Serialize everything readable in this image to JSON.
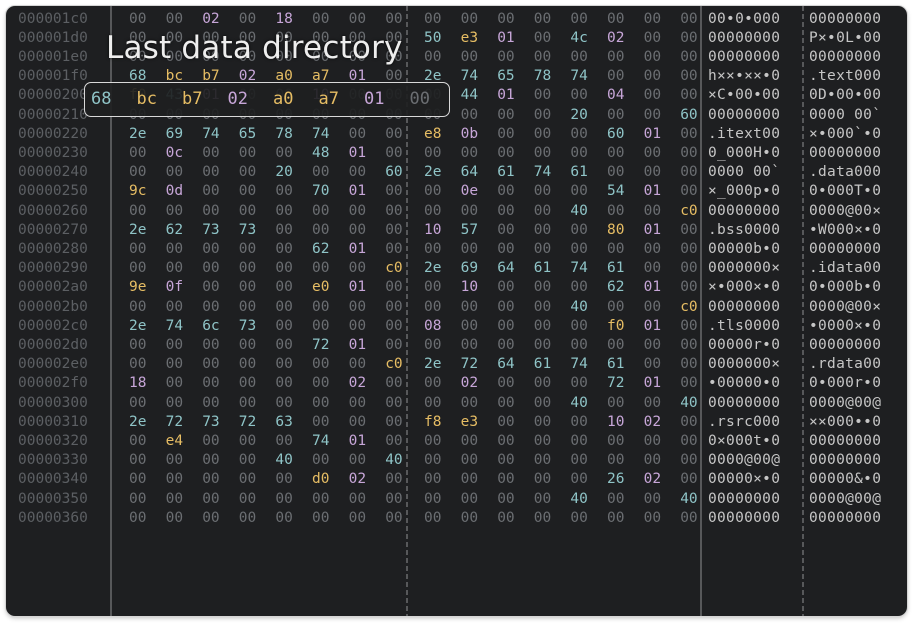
{
  "overlay": {
    "title": "Last data directory",
    "highlight_bytes": [
      {
        "text": "68",
        "color": "cyan"
      },
      {
        "text": "bc",
        "color": "yellow"
      },
      {
        "text": "b7",
        "color": "yellow"
      },
      {
        "text": "02",
        "color": "purple"
      },
      {
        "text": "a0",
        "color": "yellow"
      },
      {
        "text": "a7",
        "color": "yellow"
      },
      {
        "text": "01",
        "color": "purple"
      },
      {
        "text": "00",
        "color": "gray"
      }
    ]
  },
  "colors": {
    "background": "#1e1f21",
    "zero": "#6b6e72",
    "printable": "#8fc4c7",
    "high": "#e6bd64",
    "low": "#c7a6d8"
  },
  "rows": [
    {
      "offset": "000001c0",
      "bytes": [
        "00",
        "00",
        "02",
        "00",
        "18",
        "00",
        "00",
        "00",
        "00",
        "00",
        "00",
        "00",
        "00",
        "00",
        "00",
        "00"
      ],
      "ascii_a": "00•0•000",
      "ascii_b": "00000000"
    },
    {
      "offset": "000001d0",
      "bytes": [
        "00",
        "00",
        "00",
        "00",
        "00",
        "00",
        "00",
        "00",
        "50",
        "e3",
        "01",
        "00",
        "4c",
        "02",
        "00",
        "00"
      ],
      "ascii_a": "00000000",
      "ascii_b": "P×•0L•00"
    },
    {
      "offset": "000001e0",
      "bytes": [
        "00",
        "00",
        "00",
        "00",
        "00",
        "00",
        "00",
        "00",
        "00",
        "00",
        "00",
        "00",
        "00",
        "00",
        "00",
        "00"
      ],
      "ascii_a": "00000000",
      "ascii_b": "00000000"
    },
    {
      "offset": "000001f0",
      "bytes": [
        "68",
        "bc",
        "b7",
        "02",
        "a0",
        "a7",
        "01",
        "00",
        "2e",
        "74",
        "65",
        "78",
        "74",
        "00",
        "00",
        "00"
      ],
      "ascii_a": "h××•××•0",
      "ascii_b": ".text000"
    },
    {
      "offset": "00000200",
      "bytes": [
        "f0",
        "43",
        "01",
        "00",
        "00",
        "10",
        "00",
        "00",
        "00",
        "44",
        "01",
        "00",
        "00",
        "04",
        "00",
        "00"
      ],
      "ascii_a": "×C•00•00",
      "ascii_b": "0D•00•00"
    },
    {
      "offset": "00000210",
      "bytes": [
        "00",
        "00",
        "00",
        "00",
        "00",
        "00",
        "00",
        "00",
        "00",
        "00",
        "00",
        "00",
        "20",
        "00",
        "00",
        "60"
      ],
      "ascii_a": "00000000",
      "ascii_b": "0000 00`"
    },
    {
      "offset": "00000220",
      "bytes": [
        "2e",
        "69",
        "74",
        "65",
        "78",
        "74",
        "00",
        "00",
        "e8",
        "0b",
        "00",
        "00",
        "00",
        "60",
        "01",
        "00"
      ],
      "ascii_a": ".itext00",
      "ascii_b": "×•000`•0"
    },
    {
      "offset": "00000230",
      "bytes": [
        "00",
        "0c",
        "00",
        "00",
        "00",
        "48",
        "01",
        "00",
        "00",
        "00",
        "00",
        "00",
        "00",
        "00",
        "00",
        "00"
      ],
      "ascii_a": "0_000H•0",
      "ascii_b": "00000000"
    },
    {
      "offset": "00000240",
      "bytes": [
        "00",
        "00",
        "00",
        "00",
        "20",
        "00",
        "00",
        "60",
        "2e",
        "64",
        "61",
        "74",
        "61",
        "00",
        "00",
        "00"
      ],
      "ascii_a": "0000 00`",
      "ascii_b": ".data000"
    },
    {
      "offset": "00000250",
      "bytes": [
        "9c",
        "0d",
        "00",
        "00",
        "00",
        "70",
        "01",
        "00",
        "00",
        "0e",
        "00",
        "00",
        "00",
        "54",
        "01",
        "00"
      ],
      "ascii_a": "×_000p•0",
      "ascii_b": "0•000T•0"
    },
    {
      "offset": "00000260",
      "bytes": [
        "00",
        "00",
        "00",
        "00",
        "00",
        "00",
        "00",
        "00",
        "00",
        "00",
        "00",
        "00",
        "40",
        "00",
        "00",
        "c0"
      ],
      "ascii_a": "00000000",
      "ascii_b": "0000@00×"
    },
    {
      "offset": "00000270",
      "bytes": [
        "2e",
        "62",
        "73",
        "73",
        "00",
        "00",
        "00",
        "00",
        "10",
        "57",
        "00",
        "00",
        "00",
        "80",
        "01",
        "00"
      ],
      "ascii_a": ".bss0000",
      "ascii_b": "•W000×•0"
    },
    {
      "offset": "00000280",
      "bytes": [
        "00",
        "00",
        "00",
        "00",
        "00",
        "62",
        "01",
        "00",
        "00",
        "00",
        "00",
        "00",
        "00",
        "00",
        "00",
        "00"
      ],
      "ascii_a": "00000b•0",
      "ascii_b": "00000000"
    },
    {
      "offset": "00000290",
      "bytes": [
        "00",
        "00",
        "00",
        "00",
        "00",
        "00",
        "00",
        "c0",
        "2e",
        "69",
        "64",
        "61",
        "74",
        "61",
        "00",
        "00"
      ],
      "ascii_a": "0000000×",
      "ascii_b": ".idata00"
    },
    {
      "offset": "000002a0",
      "bytes": [
        "9e",
        "0f",
        "00",
        "00",
        "00",
        "e0",
        "01",
        "00",
        "00",
        "10",
        "00",
        "00",
        "00",
        "62",
        "01",
        "00"
      ],
      "ascii_a": "×•000×•0",
      "ascii_b": "0•000b•0"
    },
    {
      "offset": "000002b0",
      "bytes": [
        "00",
        "00",
        "00",
        "00",
        "00",
        "00",
        "00",
        "00",
        "00",
        "00",
        "00",
        "00",
        "40",
        "00",
        "00",
        "c0"
      ],
      "ascii_a": "00000000",
      "ascii_b": "0000@00×"
    },
    {
      "offset": "000002c0",
      "bytes": [
        "2e",
        "74",
        "6c",
        "73",
        "00",
        "00",
        "00",
        "00",
        "08",
        "00",
        "00",
        "00",
        "00",
        "f0",
        "01",
        "00"
      ],
      "ascii_a": ".tls0000",
      "ascii_b": "•0000×•0"
    },
    {
      "offset": "000002d0",
      "bytes": [
        "00",
        "00",
        "00",
        "00",
        "00",
        "72",
        "01",
        "00",
        "00",
        "00",
        "00",
        "00",
        "00",
        "00",
        "00",
        "00"
      ],
      "ascii_a": "00000r•0",
      "ascii_b": "00000000"
    },
    {
      "offset": "000002e0",
      "bytes": [
        "00",
        "00",
        "00",
        "00",
        "00",
        "00",
        "00",
        "c0",
        "2e",
        "72",
        "64",
        "61",
        "74",
        "61",
        "00",
        "00"
      ],
      "ascii_a": "0000000×",
      "ascii_b": ".rdata00"
    },
    {
      "offset": "000002f0",
      "bytes": [
        "18",
        "00",
        "00",
        "00",
        "00",
        "00",
        "02",
        "00",
        "00",
        "02",
        "00",
        "00",
        "00",
        "72",
        "01",
        "00"
      ],
      "ascii_a": "•00000•0",
      "ascii_b": "0•000r•0"
    },
    {
      "offset": "00000300",
      "bytes": [
        "00",
        "00",
        "00",
        "00",
        "00",
        "00",
        "00",
        "00",
        "00",
        "00",
        "00",
        "00",
        "40",
        "00",
        "00",
        "40"
      ],
      "ascii_a": "00000000",
      "ascii_b": "0000@00@"
    },
    {
      "offset": "00000310",
      "bytes": [
        "2e",
        "72",
        "73",
        "72",
        "63",
        "00",
        "00",
        "00",
        "f8",
        "e3",
        "00",
        "00",
        "00",
        "10",
        "02",
        "00"
      ],
      "ascii_a": ".rsrc000",
      "ascii_b": "××000••0"
    },
    {
      "offset": "00000320",
      "bytes": [
        "00",
        "e4",
        "00",
        "00",
        "00",
        "74",
        "01",
        "00",
        "00",
        "00",
        "00",
        "00",
        "00",
        "00",
        "00",
        "00"
      ],
      "ascii_a": "0×000t•0",
      "ascii_b": "00000000"
    },
    {
      "offset": "00000330",
      "bytes": [
        "00",
        "00",
        "00",
        "00",
        "40",
        "00",
        "00",
        "40",
        "00",
        "00",
        "00",
        "00",
        "00",
        "00",
        "00",
        "00"
      ],
      "ascii_a": "0000@00@",
      "ascii_b": "00000000"
    },
    {
      "offset": "00000340",
      "bytes": [
        "00",
        "00",
        "00",
        "00",
        "00",
        "d0",
        "02",
        "00",
        "00",
        "00",
        "00",
        "00",
        "00",
        "26",
        "02",
        "00"
      ],
      "ascii_a": "00000×•0",
      "ascii_b": "00000&•0"
    },
    {
      "offset": "00000350",
      "bytes": [
        "00",
        "00",
        "00",
        "00",
        "00",
        "00",
        "00",
        "00",
        "00",
        "00",
        "00",
        "00",
        "40",
        "00",
        "00",
        "40"
      ],
      "ascii_a": "00000000",
      "ascii_b": "0000@00@"
    },
    {
      "offset": "00000360",
      "bytes": [
        "00",
        "00",
        "00",
        "00",
        "00",
        "00",
        "00",
        "00",
        "00",
        "00",
        "00",
        "00",
        "00",
        "00",
        "00",
        "00"
      ],
      "ascii_a": "00000000",
      "ascii_b": "00000000"
    }
  ]
}
